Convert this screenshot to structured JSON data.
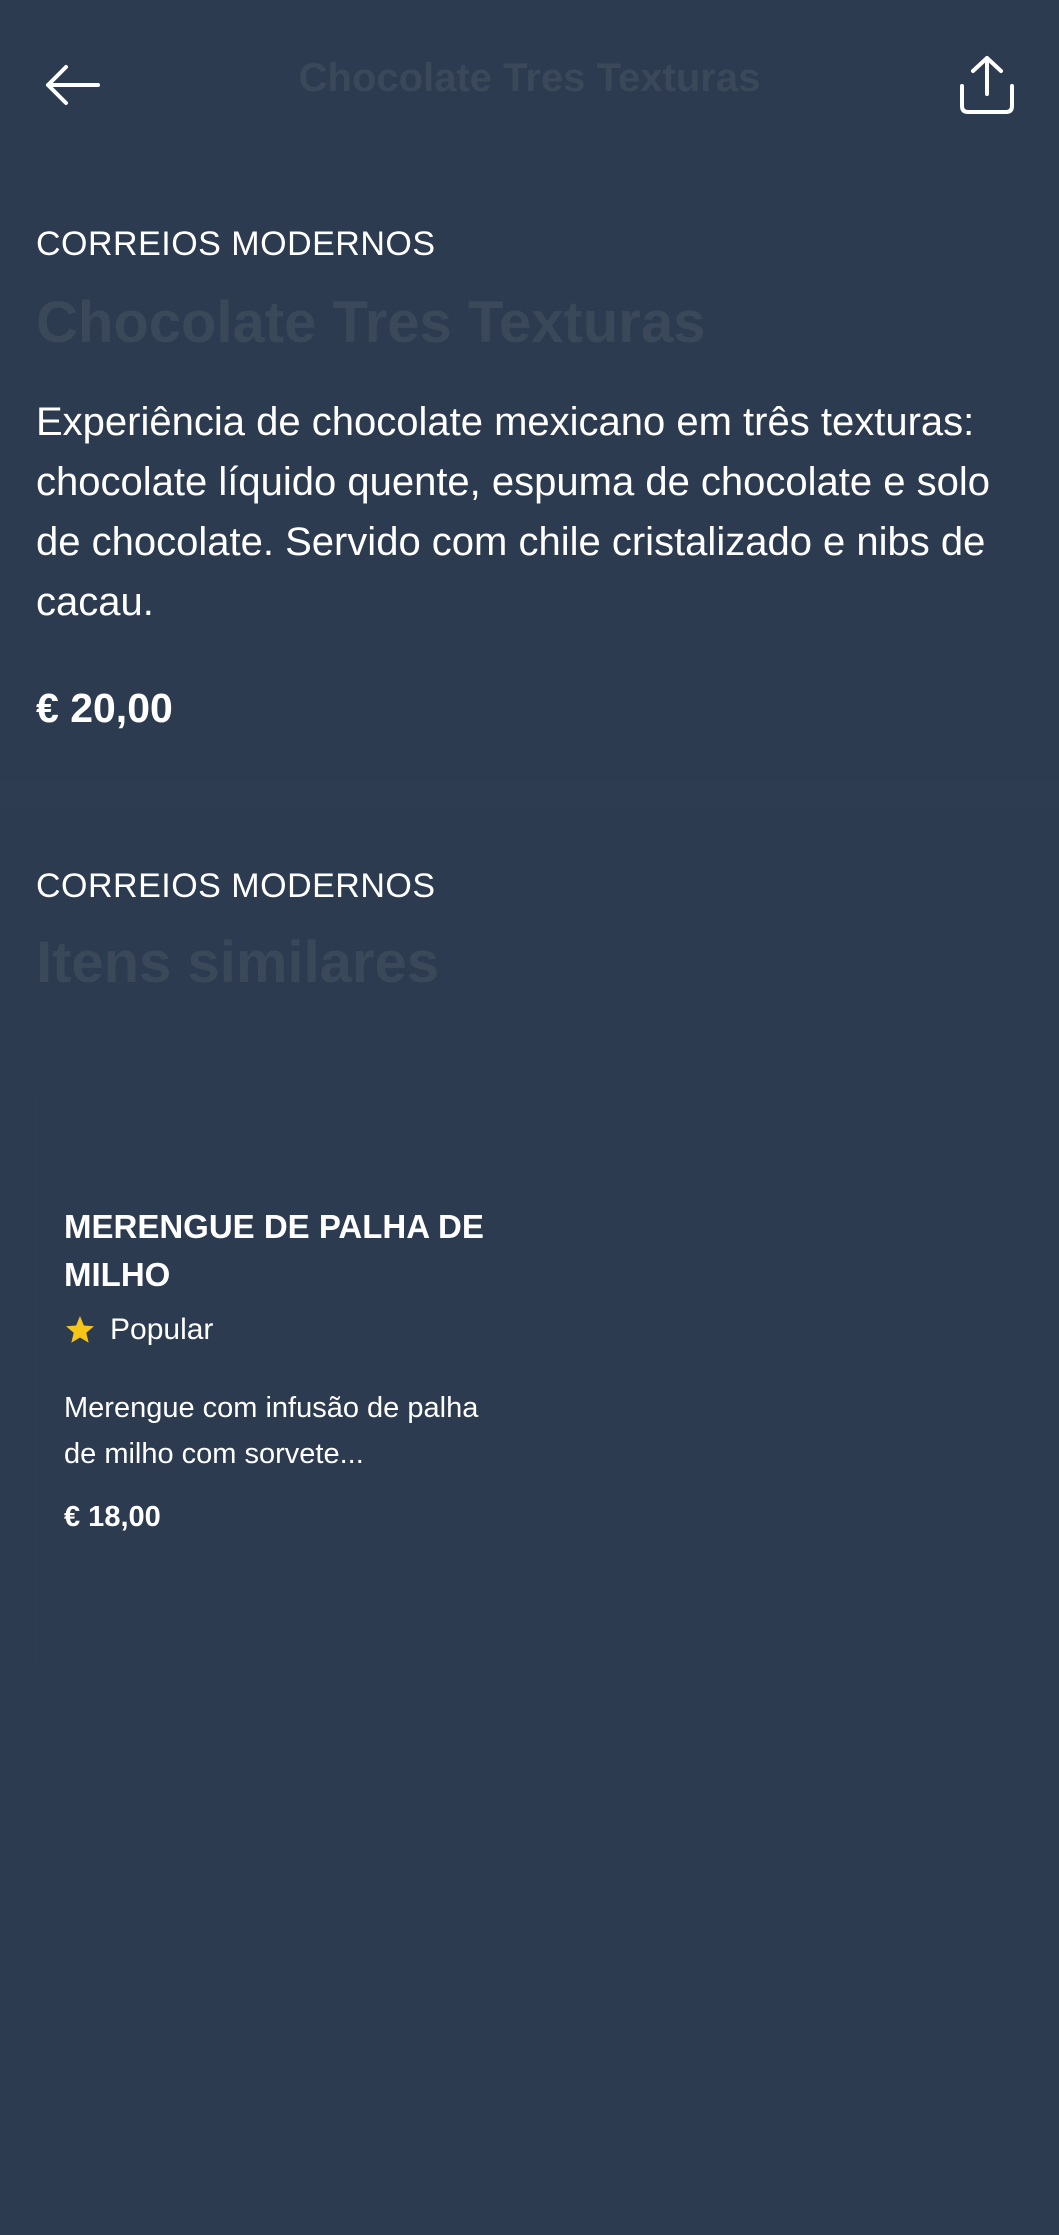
{
  "header": {
    "title": "Chocolate Tres Texturas",
    "back_icon": "arrow-left-icon",
    "share_icon": "share-icon"
  },
  "product": {
    "restaurant": "CORREIOS MODERNOS",
    "title": "Chocolate Tres Texturas",
    "description": "Experiência de chocolate mexicano em três texturas: chocolate líquido quente, espuma de chocolate e solo de chocolate. Servido com chile cristalizado e nibs de cacau.",
    "price": "€ 20,00"
  },
  "similar": {
    "restaurant": "CORREIOS MODERNOS",
    "heading": "Itens similares",
    "items": [
      {
        "name": "MERENGUE DE PALHA DE MILHO",
        "badge": "Popular",
        "description": "Merengue com infusão de palha de milho com sorvete...",
        "price": "€ 18,00"
      }
    ]
  },
  "colors": {
    "background": "#2c3b4f",
    "star": "#f5c518",
    "faded_text": "#3a485a"
  }
}
